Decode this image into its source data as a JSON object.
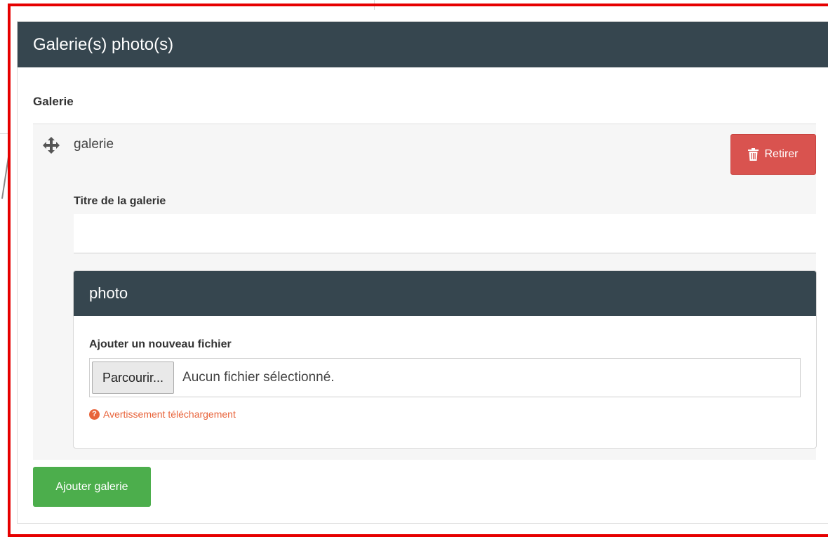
{
  "panel": {
    "title": "Galerie(s) photo(s)"
  },
  "section": {
    "label": "Galerie"
  },
  "gallery_item": {
    "label": "galerie",
    "remove_label": "Retirer",
    "title_field_label": "Titre de la galerie",
    "title_field_value": ""
  },
  "photo_panel": {
    "title": "photo",
    "file_label": "Ajouter un nouveau fichier",
    "browse_label": "Parcourir...",
    "file_status": "Aucun fichier sélectionné.",
    "warning_text": "Avertissement téléchargement"
  },
  "actions": {
    "add_gallery_label": "Ajouter galerie"
  },
  "icons": {
    "move": "move-arrows-icon",
    "trash": "trash-icon",
    "warning": "question-circle-icon"
  },
  "colors": {
    "header": "#36464f",
    "danger": "#d9534f",
    "success": "#4cae4c",
    "warning": "#e8643b",
    "highlight": "#e60000"
  }
}
